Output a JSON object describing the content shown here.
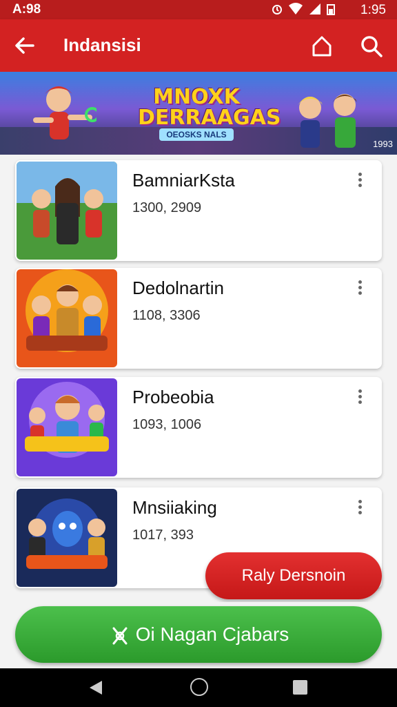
{
  "status_bar": {
    "time_left": "A:98",
    "time_right": "1:95"
  },
  "app_bar": {
    "title": "Indansisi"
  },
  "banner": {
    "logo_line1": "MNOXK",
    "logo_line2": "DERRAAGAS",
    "logo_sub": "OEOSKS NALS",
    "corner": "1993"
  },
  "items": [
    {
      "title": "BamniarKsta",
      "meta": "1300, 2909"
    },
    {
      "title": "Dedolnartin",
      "meta": "1108, 3306"
    },
    {
      "title": "Probeobia",
      "meta": "1093, 1006"
    },
    {
      "title": "Mnsiiaking",
      "meta": "1017, 393"
    }
  ],
  "fab": {
    "label": "Raly Dersnoin"
  },
  "cta": {
    "label": "Oi Nagan Cjabars"
  },
  "colors": {
    "primary": "#d32222",
    "cta": "#35a835"
  },
  "icons": [
    "back-arrow-icon",
    "home-icon",
    "search-icon",
    "more-vert-icon",
    "joystick-icon"
  ]
}
